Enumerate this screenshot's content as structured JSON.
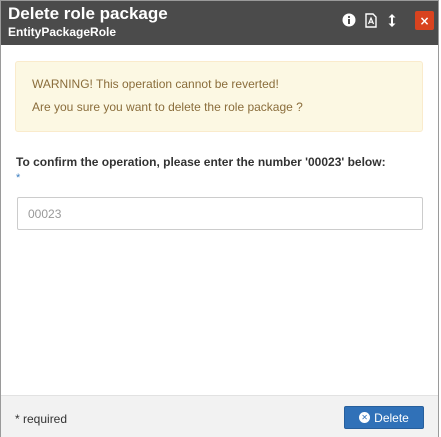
{
  "dialog": {
    "title": "Delete role package",
    "subtitle": "EntityPackageRole",
    "close_label": "×"
  },
  "titlebar_icons": [
    "info-icon",
    "pdf-icon",
    "resize-icon",
    "close-icon"
  ],
  "warning": {
    "line1": "WARNING! This operation cannot be reverted!",
    "line2": "Are you sure you want to delete the role package ?"
  },
  "confirm": {
    "label": "To confirm the operation, please enter the number '00023' below:",
    "required_marker": "*",
    "placeholder": "00023",
    "value": ""
  },
  "footer": {
    "required_note": "* required",
    "delete_label": "Delete"
  },
  "colors": {
    "titlebar": "#4b4b4b",
    "close": "#d9431f",
    "warning_bg": "#fcf8e3",
    "warning_text": "#8a6d3b",
    "primary": "#3071b8"
  }
}
